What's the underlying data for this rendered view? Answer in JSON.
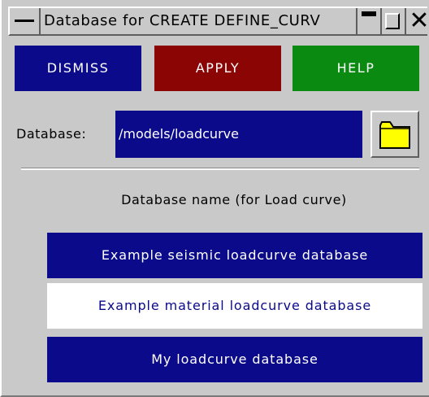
{
  "window": {
    "title": "Database for CREATE DEFINE_CURV"
  },
  "toolbar": {
    "dismiss_label": "DISMISS",
    "apply_label": "APPLY",
    "help_label": "HELP"
  },
  "database": {
    "label": "Database:",
    "path": "/models/loadcurve",
    "browse_icon": "folder-icon"
  },
  "list": {
    "title": "Database name (for Load curve)",
    "items": [
      {
        "label": "Example seismic loadcurve database",
        "selected": false
      },
      {
        "label": "Example material loadcurve database",
        "selected": true
      },
      {
        "label": "My loadcurve database",
        "selected": false
      }
    ]
  },
  "colors": {
    "dismiss": "#0b0a8a",
    "apply": "#8b0505",
    "help": "#0b8a12",
    "panel": "#c9c9c9",
    "selected_item_bg": "#ffffff"
  }
}
